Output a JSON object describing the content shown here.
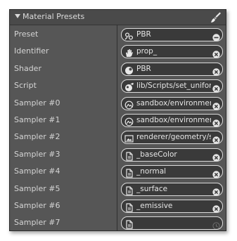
{
  "panel": {
    "title": "Material Presets"
  },
  "rows": [
    {
      "label": "Preset",
      "value": "PBR",
      "icon": "preset-icon",
      "clear": "minus-circle-icon"
    },
    {
      "label": "Identifier",
      "value": "prop_",
      "icon": "hand-icon",
      "clear": "x-circle-icon"
    },
    {
      "label": "Shader",
      "value": "PBR",
      "icon": "shader-icon",
      "clear": "x-circle-icon"
    },
    {
      "label": "Script",
      "value": "lib/Scripts/set_uniform",
      "icon": "script-icon",
      "clear": "x-circle-icon"
    },
    {
      "label": "Sampler #0",
      "value": "sandbox/environment",
      "icon": "environment-icon",
      "clear": "x-circle-icon"
    },
    {
      "label": "Sampler #1",
      "value": "sandbox/environment",
      "icon": "environment-icon",
      "clear": "x-circle-icon"
    },
    {
      "label": "Sampler #2",
      "value": "renderer/geometry/s",
      "icon": "image-icon",
      "clear": "x-circle-icon"
    },
    {
      "label": "Sampler #3",
      "value": "_baseColor",
      "icon": "document-icon",
      "clear": "x-circle-icon"
    },
    {
      "label": "Sampler #4",
      "value": "_normal",
      "icon": "document-icon",
      "clear": "x-circle-icon"
    },
    {
      "label": "Sampler #5",
      "value": "_surface",
      "icon": "document-icon",
      "clear": "x-circle-icon"
    },
    {
      "label": "Sampler #6",
      "value": "_emissive",
      "icon": "document-icon",
      "clear": "x-circle-icon"
    },
    {
      "label": "Sampler #7",
      "value": "",
      "icon": "document-icon",
      "clear": "reset-icon"
    }
  ]
}
